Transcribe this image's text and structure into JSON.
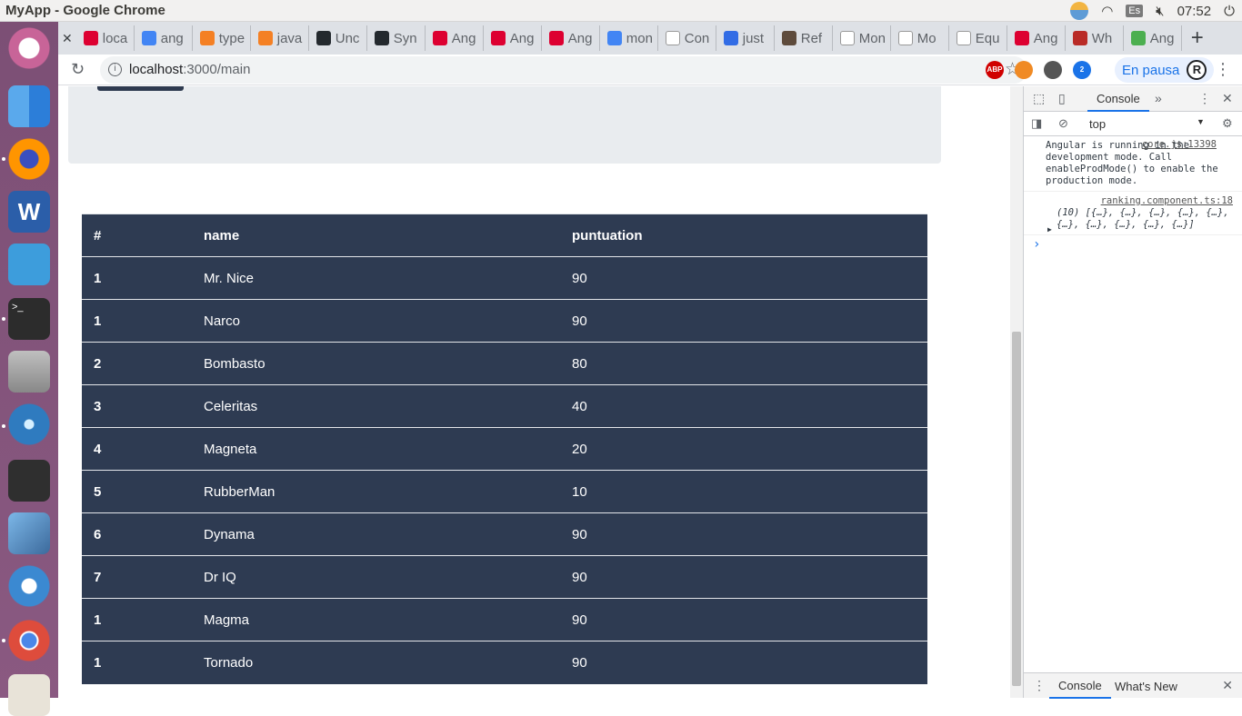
{
  "os": {
    "window_title": "MyApp - Google Chrome",
    "keyboard_layout": "Es",
    "clock": "07:52",
    "launcher_icons": [
      "ubuntu-icon",
      "finder-icon",
      "firefox-icon",
      "word-icon",
      "files-icon",
      "terminal-icon",
      "disk-icon",
      "atom-icon",
      "tablet-icon",
      "image-viewer-icon",
      "swirl-icon",
      "chrome-icon",
      "app-icon"
    ]
  },
  "browser": {
    "tabs": [
      {
        "label": "loca",
        "icon": "angular-icon",
        "color": "#dd0031"
      },
      {
        "label": "ang",
        "icon": "google-icon",
        "color": "#4285f4"
      },
      {
        "label": "type",
        "icon": "stackoverflow-icon",
        "color": "#f48024"
      },
      {
        "label": "java",
        "icon": "stackoverflow-icon",
        "color": "#f48024"
      },
      {
        "label": "Unc",
        "icon": "github-icon",
        "color": "#24292e"
      },
      {
        "label": "Syn",
        "icon": "github-icon",
        "color": "#24292e"
      },
      {
        "label": "Ang",
        "icon": "angular-icon",
        "color": "#dd0031"
      },
      {
        "label": "Ang",
        "icon": "angular-icon",
        "color": "#dd0031"
      },
      {
        "label": "Ang",
        "icon": "angular-icon",
        "color": "#dd0031"
      },
      {
        "label": "mon",
        "icon": "google-icon",
        "color": "#4285f4"
      },
      {
        "label": "Con",
        "icon": "t-icon",
        "color": "#ffffff"
      },
      {
        "label": "just",
        "icon": "gear-icon",
        "color": "#326ce5"
      },
      {
        "label": "Ref",
        "icon": "puppet-icon",
        "color": "#5e4b3c"
      },
      {
        "label": "Mon",
        "icon": "m-icon",
        "color": "#ffffff"
      },
      {
        "label": "Mo",
        "icon": "m-icon",
        "color": "#ffffff"
      },
      {
        "label": "Equ",
        "icon": "book-icon",
        "color": "#ffffff"
      },
      {
        "label": "Ang",
        "icon": "angular-icon",
        "color": "#dd0031"
      },
      {
        "label": "Wh",
        "icon": "quora-icon",
        "color": "#b92b27"
      },
      {
        "label": "Ang",
        "icon": "w3-icon",
        "color": "#4caf50"
      }
    ],
    "new_tab": "+",
    "url_host": "localhost",
    "url_path": ":3000/main",
    "pause_label": "En pausa",
    "profile_initial": "R",
    "extensions": [
      {
        "name": "adblock-icon",
        "label": "ABP",
        "color": "#d00000"
      },
      {
        "name": "fire-icon",
        "label": "",
        "color": "#f08a24"
      },
      {
        "name": "shield-icon",
        "label": "",
        "color": "#555555"
      },
      {
        "name": "tab-count-icon",
        "label": "2",
        "color": "#1a73e8"
      }
    ]
  },
  "ranking": {
    "headers": [
      "#",
      "name",
      "puntuation"
    ],
    "rows": [
      {
        "rank": "1",
        "name": "Mr. Nice",
        "score": "90"
      },
      {
        "rank": "1",
        "name": "Narco",
        "score": "90"
      },
      {
        "rank": "2",
        "name": "Bombasto",
        "score": "80"
      },
      {
        "rank": "3",
        "name": "Celeritas",
        "score": "40"
      },
      {
        "rank": "4",
        "name": "Magneta",
        "score": "20"
      },
      {
        "rank": "5",
        "name": "RubberMan",
        "score": "10"
      },
      {
        "rank": "6",
        "name": "Dynama",
        "score": "90"
      },
      {
        "rank": "7",
        "name": "Dr IQ",
        "score": "90"
      },
      {
        "rank": "1",
        "name": "Magma",
        "score": "90"
      },
      {
        "rank": "1",
        "name": "Tornado",
        "score": "90"
      }
    ]
  },
  "devtools": {
    "tab_console": "Console",
    "context": "top",
    "messages": [
      {
        "text": "Angular is running in the development mode. Call enableProdMode() to enable the production mode.",
        "source": "core.js:13398"
      },
      {
        "text": "(10) [{…}, {…}, {…}, {…}, {…}, {…}, {…}, {…}, {…}, {…}]",
        "source": "ranking.component.ts:18"
      }
    ],
    "drawer_tabs": [
      "Console",
      "What's New"
    ]
  }
}
